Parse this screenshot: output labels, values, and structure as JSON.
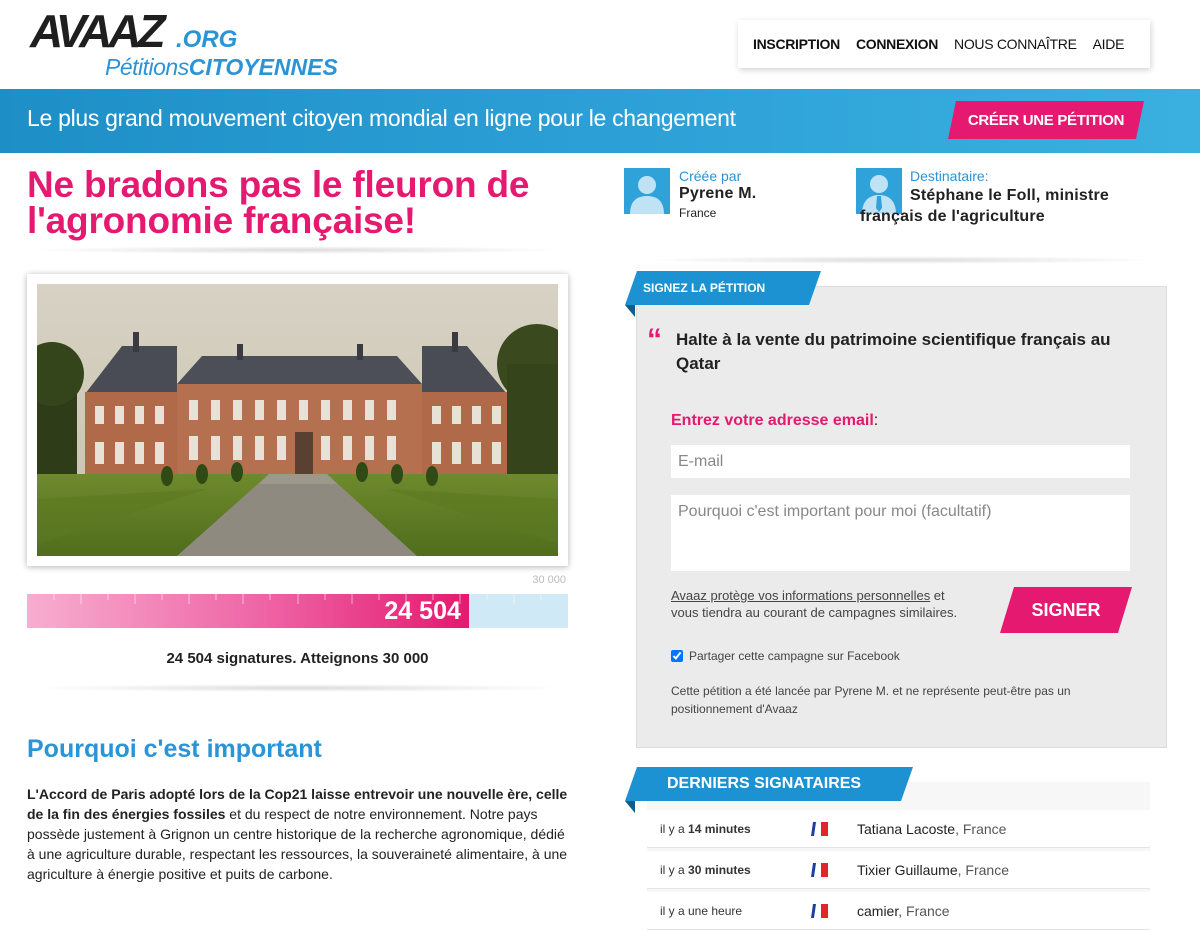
{
  "header": {
    "logo_main": "AVAAZ",
    "logo_org": ".ORG",
    "logo_sub_a": "Pétitions",
    "logo_sub_b": "CITOYENNES",
    "nav": [
      "INSCRIPTION",
      "CONNEXION",
      "NOUS CONNAÎTRE",
      "AIDE"
    ]
  },
  "banner": {
    "tagline": "Le plus grand mouvement citoyen mondial en ligne pour le changement",
    "create_label": "CRÉER UNE PÉTITION"
  },
  "petition": {
    "title": "Ne bradons pas le fleuron de l'agronomie française!",
    "goal_label": "30 000",
    "count_label": "24 504",
    "progress_fraction": 0.8168,
    "caption": "24 504 signatures. Atteignons 30 000",
    "why_title": "Pourquoi c'est important",
    "why_bold": "L'Accord de Paris adopté lors de la Cop21 laisse entrevoir une nouvelle ère, celle de la fin des énergies fossiles",
    "why_text": " et du respect de notre environnement. Notre pays possède justement à Grignon un centre historique de la recherche agronomique, dédié à une agriculture durable, respectant les ressources, la souveraineté alimentaire, à une agriculture à énergie positive et puits de carbone."
  },
  "creator": {
    "label": "Créée par",
    "name": "Pyrene M.",
    "country": "France"
  },
  "recipient": {
    "label": "Destinataire:",
    "name": "Stéphane le Foll, ministre français de l'agriculture"
  },
  "sign": {
    "ribbon": "SIGNEZ LA PÉTITION",
    "quote": "Halte à la vente du patrimoine scientifique français au Qatar",
    "email_label": "Entrez votre adresse email",
    "email_colon": ":",
    "email_placeholder": "E-mail",
    "why_placeholder": "Pourquoi c'est important pour moi (facultatif)",
    "privacy_link": "Avaaz protège vos informations personnelles",
    "privacy_text": " et vous tiendra au courant de campagnes similaires.",
    "button": "SIGNER",
    "share_label": "Partager cette campagne sur Facebook",
    "disclaimer": "Cette pétition a été lancée par Pyrene M. et ne représente peut-être pas un positionnement d'Avaaz"
  },
  "recent": {
    "ribbon": "DERNIERS SIGNATAIRES",
    "rows": [
      {
        "prefix": "il y a ",
        "time": "14 minutes",
        "name": "Tatiana Lacoste",
        "country": ", France"
      },
      {
        "prefix": "il y a ",
        "time": "30 minutes",
        "name": "Tixier Guillaume",
        "country": ", France"
      },
      {
        "prefix": "il y a une heure",
        "time": "",
        "name": "camier",
        "country": ", France"
      }
    ]
  },
  "colors": {
    "brand_pink": "#e5196f",
    "brand_blue": "#2a94d6"
  }
}
